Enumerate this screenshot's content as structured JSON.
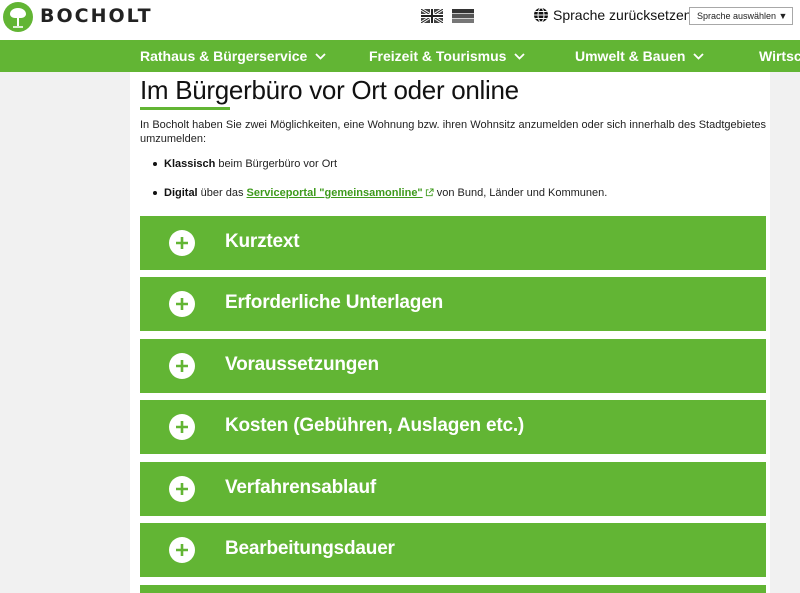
{
  "header": {
    "brand": "BOCHOLT",
    "logo_icon": "tree-logo-icon",
    "flags": [
      "uk-flag-icon",
      "german-flag-icon"
    ],
    "reset_label": "Sprache zurücksetzen",
    "language_select": "Sprache auswählen ▼"
  },
  "nav": {
    "items": [
      {
        "label": "Rathaus & Bürgerservice"
      },
      {
        "label": "Freizeit & Tourismus"
      },
      {
        "label": "Umwelt & Bauen"
      },
      {
        "label": "Wirtsch"
      }
    ]
  },
  "main": {
    "title": "Im Bürgerbüro vor Ort oder online",
    "intro": "In Bocholt haben Sie zwei Möglichkeiten, eine Wohnung bzw. ihren Wohnsitz anzumelden oder sich innerhalb des Stadtgebietes umzumelden:",
    "bullets": [
      {
        "strong": "Klassisch",
        "text": " beim Bürgerbüro vor Ort"
      },
      {
        "strong": "Digital",
        "text_before": " über das ",
        "link": "Serviceportal \"gemeinsamonline\"",
        "text_after": " von Bund, Länder und Kommunen."
      }
    ],
    "accordion": [
      {
        "label": "Kurztext"
      },
      {
        "label": "Erforderliche Unterlagen"
      },
      {
        "label": "Voraussetzungen"
      },
      {
        "label": "Kosten (Gebühren, Auslagen etc.)"
      },
      {
        "label": "Verfahrensablauf"
      },
      {
        "label": "Bearbeitungsdauer"
      },
      {
        "label": ""
      }
    ]
  },
  "colors": {
    "brand_green": "#62b534",
    "link_green": "#3e9a1c"
  }
}
